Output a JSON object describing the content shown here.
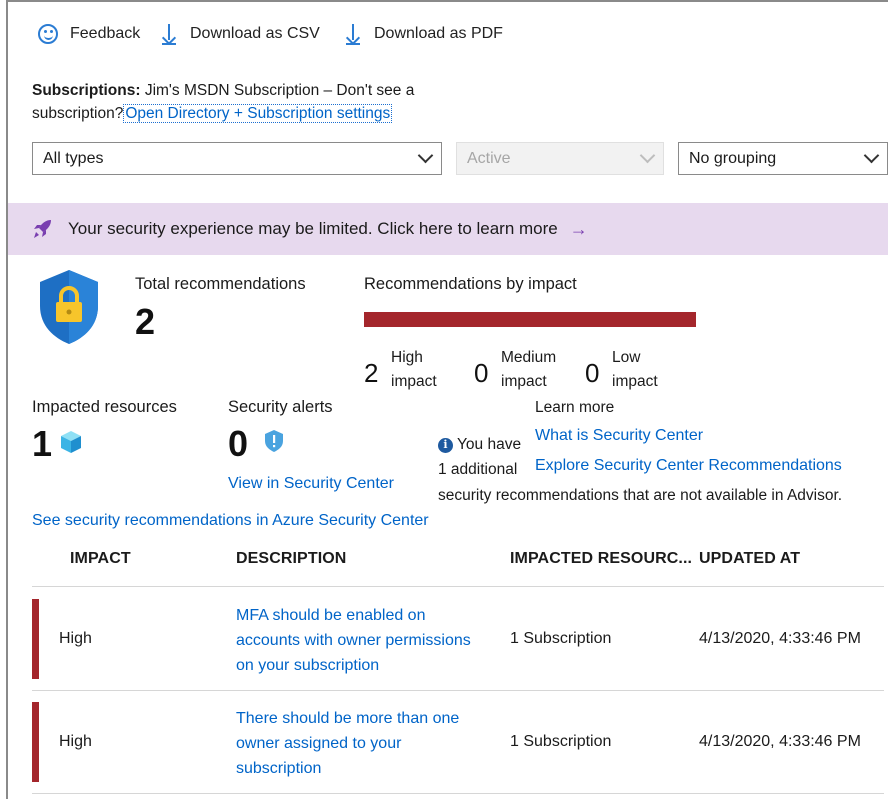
{
  "toolbar": {
    "feedback": "Feedback",
    "download_csv": "Download as CSV",
    "download_pdf": "Download as PDF"
  },
  "subscriptions": {
    "label": "Subscriptions:",
    "value": "Jim's MSDN Subscription – Don't see a",
    "hint": "subscription?",
    "link": "Open Directory + Subscription settings"
  },
  "filters": {
    "type": "All types",
    "status": "Active",
    "grouping": "No grouping"
  },
  "banner": {
    "text": "Your security experience may be limited. Click here to learn more",
    "arrow": "→"
  },
  "summary": {
    "total_label": "Total recommendations",
    "total_value": "2",
    "by_impact_label": "Recommendations by impact",
    "high": {
      "count": "2",
      "line1": "High",
      "line2": "impact"
    },
    "medium": {
      "count": "0",
      "line1": "Medium",
      "line2": "impact"
    },
    "low": {
      "count": "0",
      "line1": "Low",
      "line2": "impact"
    },
    "impacted_label": "Impacted resources",
    "impacted_value": "1",
    "alerts_label": "Security alerts",
    "alerts_value": "0",
    "view_link": "View in Security Center",
    "learn_more": "Learn more",
    "learn_link1": "What is Security Center",
    "learn_link2": "Explore Security Center Recommendations",
    "info_line1": "You have",
    "info_line2": "1 additional",
    "info_line3": "security recommendations that are not available in Advisor.",
    "see_link": "See security recommendations in Azure Security Center"
  },
  "table": {
    "columns": [
      "IMPACT",
      "DESCRIPTION",
      "IMPACTED RESOURC...",
      "UPDATED AT"
    ],
    "rows": [
      {
        "impact": "High",
        "desc1": "MFA should be enabled on",
        "desc2": "accounts with owner permissions",
        "desc3": "on your subscription",
        "resources": "1 Subscription",
        "updated": "4/13/2020, 4:33:46 PM"
      },
      {
        "impact": "High",
        "desc1": "There should be more than one",
        "desc2": "owner assigned to your",
        "desc3": "subscription",
        "resources": "1 Subscription",
        "updated": "4/13/2020, 4:33:46 PM"
      }
    ]
  },
  "colors": {
    "accent": "#0064c8",
    "high_impact": "#a4262c",
    "banner_bg": "#e7d9ee"
  }
}
